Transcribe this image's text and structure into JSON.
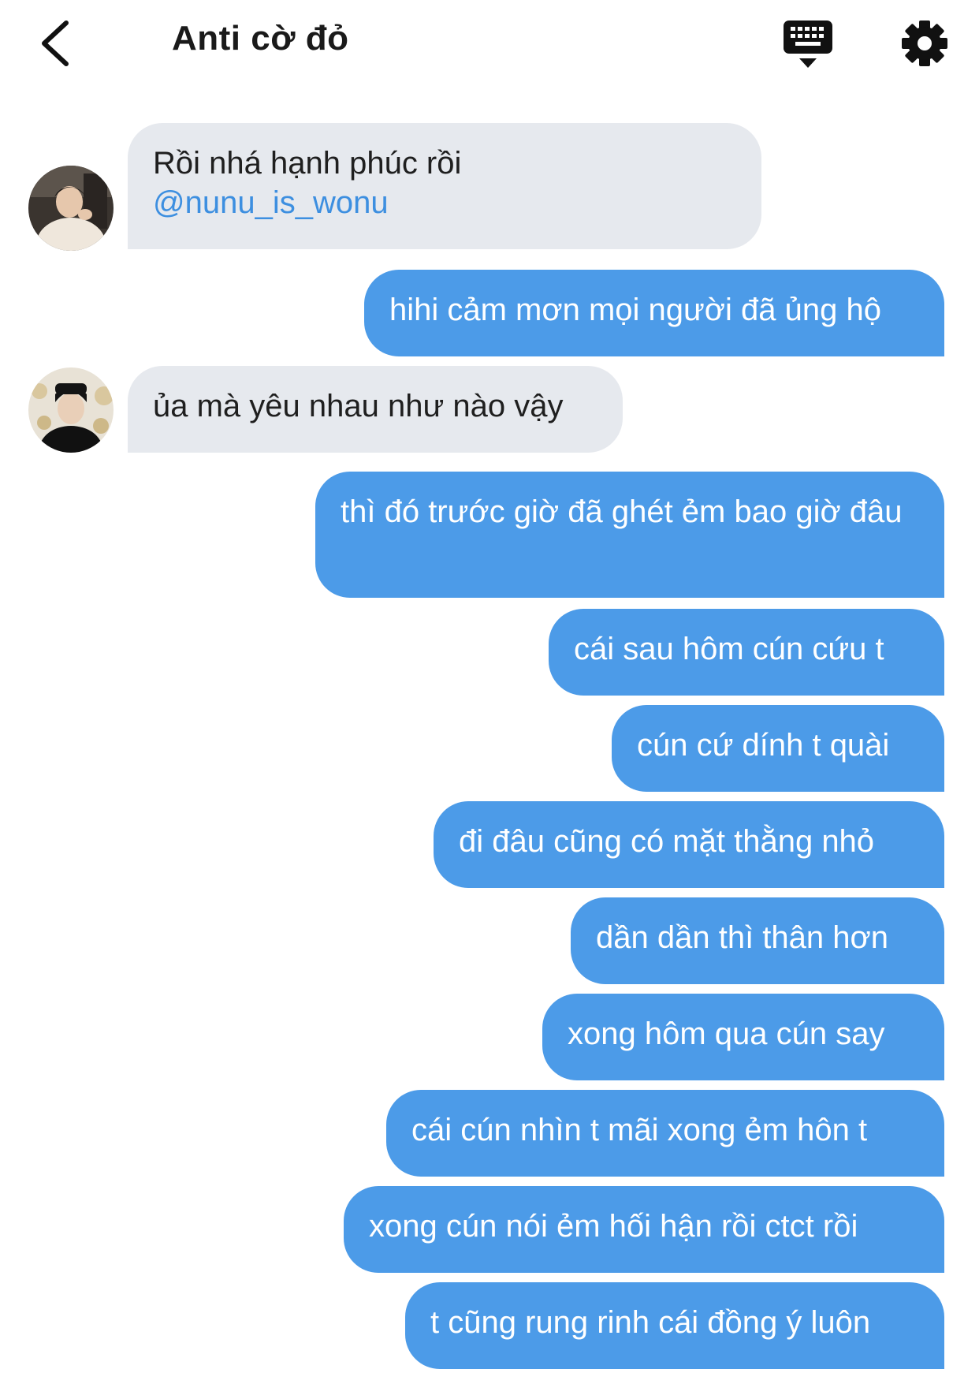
{
  "header": {
    "title": "Anti cờ đỏ",
    "back_icon": "chevron-left-icon",
    "keyboard_icon": "keyboard-icon",
    "settings_icon": "gear-icon"
  },
  "colors": {
    "outgoing_bubble": "#4c9be8",
    "incoming_bubble": "#e6e9ee",
    "mention": "#3d8fe0"
  },
  "messages": [
    {
      "direction": "in",
      "text": "Rồi nhá hạnh phúc rồi",
      "mention": "@nunu_is_wonu"
    },
    {
      "direction": "out",
      "text": "hihi cảm mơn mọi người đã ủng hộ"
    },
    {
      "direction": "in",
      "text": "ủa mà yêu nhau như nào vậy"
    },
    {
      "direction": "out",
      "text": "thì đó trước giờ đã ghét ẻm bao giờ đâu"
    },
    {
      "direction": "out",
      "text": "cái sau hôm cún cứu t"
    },
    {
      "direction": "out",
      "text": "cún cứ dính t quài"
    },
    {
      "direction": "out",
      "text": "đi đâu cũng có mặt thằng nhỏ"
    },
    {
      "direction": "out",
      "text": "dần dần thì thân hơn"
    },
    {
      "direction": "out",
      "text": "xong hôm qua cún say"
    },
    {
      "direction": "out",
      "text": "cái cún nhìn t mãi xong ẻm hôn t"
    },
    {
      "direction": "out",
      "text": "xong cún nói ẻm hối hận rồi ctct rồi"
    },
    {
      "direction": "out",
      "text": "t cũng rung rinh cái đồng ý luôn"
    }
  ]
}
